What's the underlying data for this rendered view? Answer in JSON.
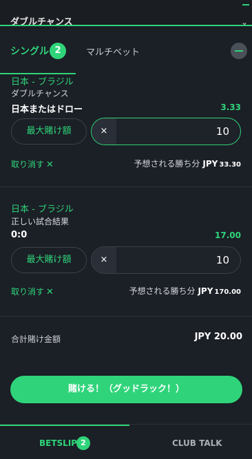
{
  "header": {
    "title": "ダブルチャンス",
    "chevron_icon": "chevron-down-icon"
  },
  "tabs": {
    "single_label": "シングル",
    "single_count": "2",
    "multi_label": "マルチベット",
    "collapse_icon": "minus-circle-icon"
  },
  "bets": [
    {
      "match": "日本 - ブラジル",
      "market": "ダブルチャンス",
      "selection": "日本またはドロー",
      "odds": "3.33",
      "max_stake_label": "最大賭け額",
      "clear_label": "×",
      "stake": "10",
      "remove_label": "取り消す",
      "remove_icon": "✕",
      "est_label": "予想される勝ち分",
      "currency": "JPY",
      "est_amount": "33.30"
    },
    {
      "match": "日本 - ブラジル",
      "market": "正しい試合結果",
      "selection": "0:0",
      "odds": "17.00",
      "max_stake_label": "最大賭け額",
      "clear_label": "×",
      "stake": "10",
      "remove_label": "取り消す",
      "remove_icon": "✕",
      "est_label": "予想される勝ち分",
      "currency": "JPY",
      "est_amount": "170.00"
    }
  ],
  "total": {
    "label": "合計賭け金額",
    "value": "JPY  20.00"
  },
  "place_bet_label": "賭ける！（グッドラック！）",
  "bottom_nav": {
    "betslip_label": "BETSLIP",
    "betslip_count": "2",
    "clubtalk_label": "CLUB TALK"
  },
  "colors": {
    "accent": "#2fd47a",
    "background": "#1b1f26"
  }
}
